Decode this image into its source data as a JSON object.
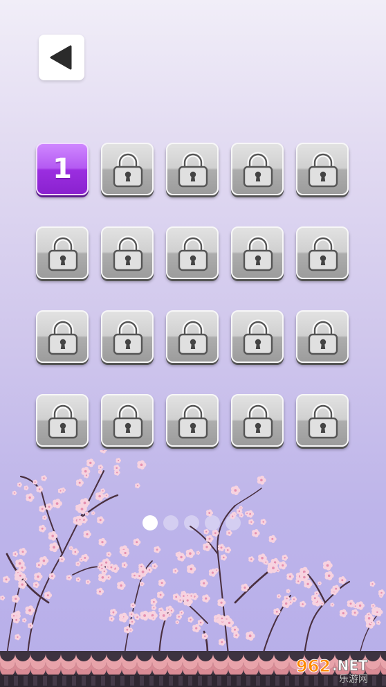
{
  "back_button": {
    "icon": "triangle-left-icon"
  },
  "levels": {
    "columns": 5,
    "rows": 4,
    "items": [
      {
        "label": "1",
        "state": "unlocked"
      },
      {
        "label": "",
        "state": "locked"
      },
      {
        "label": "",
        "state": "locked"
      },
      {
        "label": "",
        "state": "locked"
      },
      {
        "label": "",
        "state": "locked"
      },
      {
        "label": "",
        "state": "locked"
      },
      {
        "label": "",
        "state": "locked"
      },
      {
        "label": "",
        "state": "locked"
      },
      {
        "label": "",
        "state": "locked"
      },
      {
        "label": "",
        "state": "locked"
      },
      {
        "label": "",
        "state": "locked"
      },
      {
        "label": "",
        "state": "locked"
      },
      {
        "label": "",
        "state": "locked"
      },
      {
        "label": "",
        "state": "locked"
      },
      {
        "label": "",
        "state": "locked"
      },
      {
        "label": "",
        "state": "locked"
      },
      {
        "label": "",
        "state": "locked"
      },
      {
        "label": "",
        "state": "locked"
      },
      {
        "label": "",
        "state": "locked"
      },
      {
        "label": "",
        "state": "locked"
      }
    ]
  },
  "pagination": {
    "pages": 5,
    "current": 1
  },
  "watermark": {
    "brand_number": "962",
    "brand_suffix": ".NET",
    "tagline": "乐游网"
  },
  "colors": {
    "unlocked_tile": "#a63ff0",
    "locked_tile": "#b4b4b4",
    "background_top": "#f1eef8",
    "background_bottom": "#b7aee9",
    "blossom": "#f4c5d8",
    "branch": "#4a3040",
    "wall": "#e3a0a8"
  }
}
